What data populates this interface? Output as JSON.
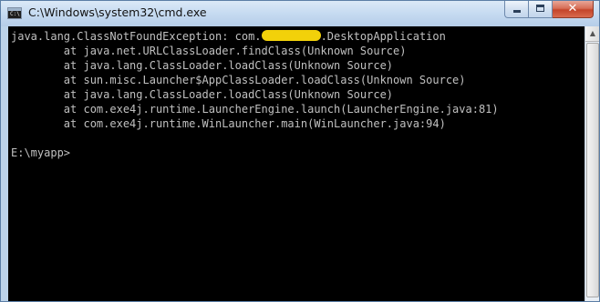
{
  "window": {
    "title": "C:\\Windows\\system32\\cmd.exe",
    "icon": "cmd-console-icon",
    "controls": {
      "minimize": "minimize-icon",
      "maximize": "maximize-icon",
      "close": "close-icon",
      "close_glyph": "✕"
    }
  },
  "console": {
    "line1_prefix": "java.lang.ClassNotFoundException: com.",
    "line1_redacted": "xxxxxxxxx",
    "line1_suffix": ".DesktopApplication",
    "line2": "        at java.net.URLClassLoader.findClass(Unknown Source)",
    "line3": "        at java.lang.ClassLoader.loadClass(Unknown Source)",
    "line4": "        at sun.misc.Launcher$AppClassLoader.loadClass(Unknown Source)",
    "line5": "        at java.lang.ClassLoader.loadClass(Unknown Source)",
    "line6": "        at com.exe4j.runtime.LauncherEngine.launch(LauncherEngine.java:81)",
    "line7": "        at com.exe4j.runtime.WinLauncher.main(WinLauncher.java:94)",
    "line8": "",
    "line9": "E:\\myapp>"
  },
  "colors": {
    "console_background": "#000000",
    "console_text": "#c0c0c0",
    "redaction": "#f2d10a",
    "titlebar": "#c6dbf1"
  }
}
